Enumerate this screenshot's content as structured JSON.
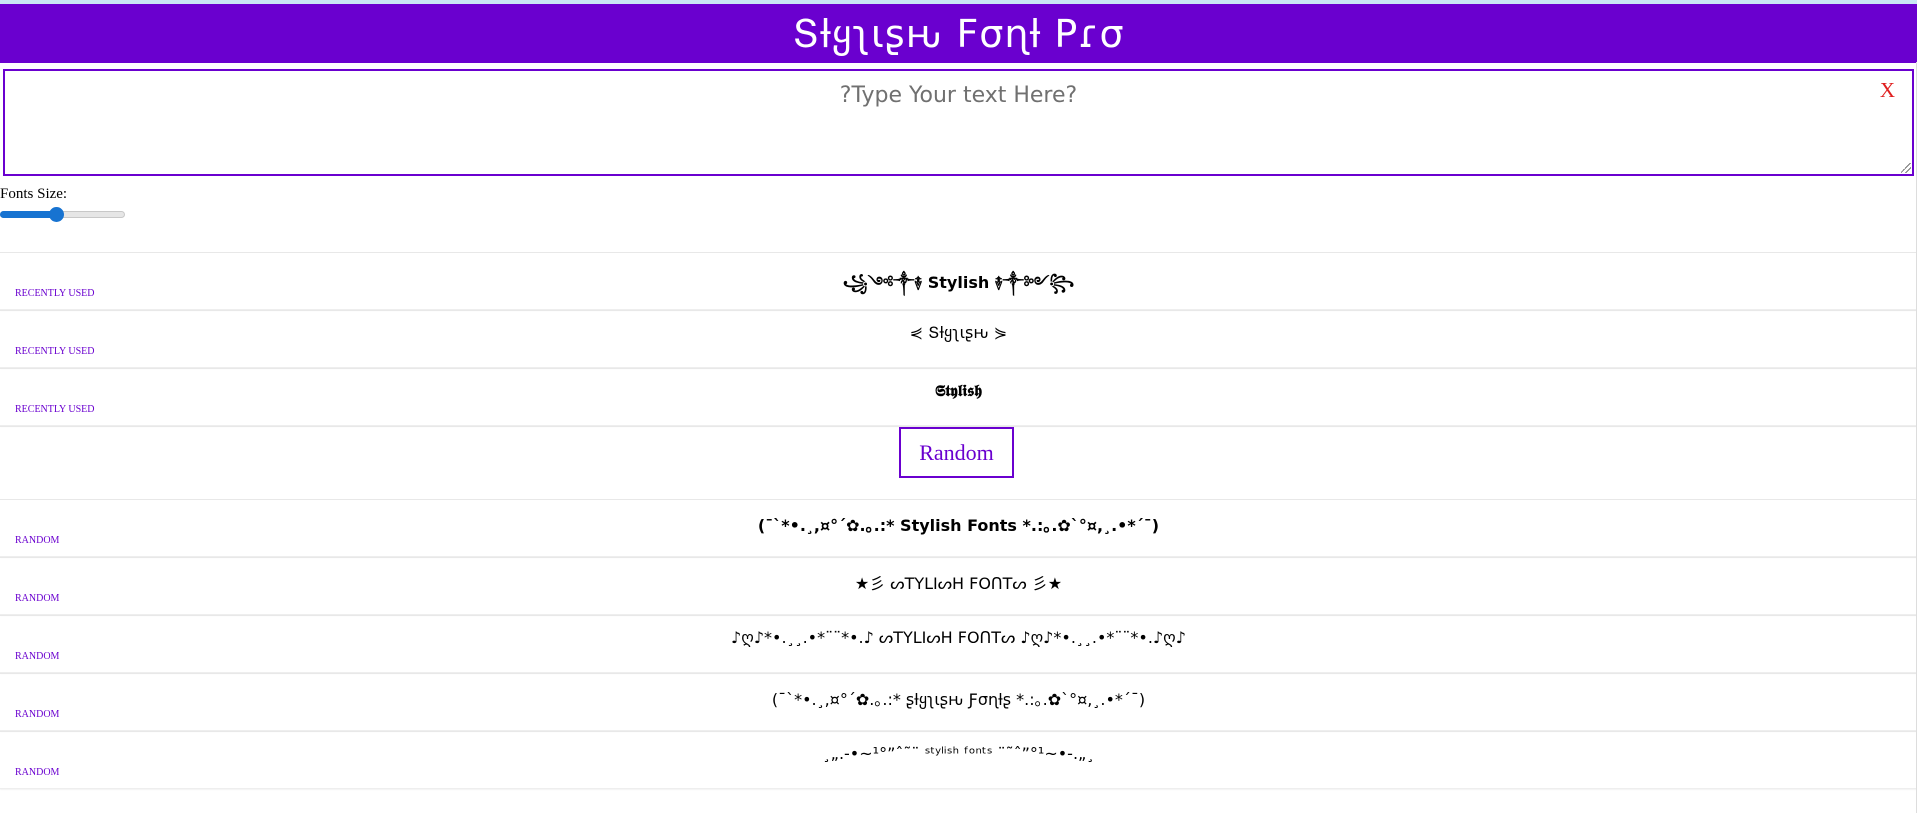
{
  "header": {
    "title": "Տƚყʅιʂԋ Fσɳƚ Pɾσ"
  },
  "input": {
    "placeholder": "?Type Your text Here?",
    "value": "",
    "clear_label": "X"
  },
  "font_size": {
    "label": "Fonts Size:",
    "value_fraction": 0.45
  },
  "recent": [
    {
      "text": "꧁༺༒࿈ Stylish ࿈༒༻꧂",
      "tag": "RECENTLY USED",
      "bold": true
    },
    {
      "text": "⋞ Տƚყʅιʂԋ ⋟",
      "tag": "RECENTLY USED",
      "bold": false
    },
    {
      "text": "𝕾𝖙𝖞𝖑𝖎𝖘𝖍",
      "tag": "RECENTLY USED",
      "bold": true
    }
  ],
  "random_button": {
    "label": "Random"
  },
  "random": [
    {
      "text": "(¯`*•.¸,¤°´✿.｡.:* Stylish Fonts *.:｡.✿`°¤,¸.•*´¯)",
      "tag": "RANDOM",
      "bold": true
    },
    {
      "text": "★彡 ᔕTYLIᔕH FOᑎTᔕ 彡★",
      "tag": "RANDOM",
      "bold": false
    },
    {
      "text": "♪ღ♪*•.¸¸.•*¨¨*•.♪ ᔕTYLIᔕH FOᑎTᔕ ♪ღ♪*•.¸¸.•*¨¨*•.♪ღ♪",
      "tag": "RANDOM",
      "bold": false
    },
    {
      "text": "(¯`*•.¸,¤°´✿.｡.:* ʂƚყʅιʂԋ Ƒσɳƚʂ *.:｡.✿`°¤,¸.•*´¯)",
      "tag": "RANDOM",
      "bold": false
    },
    {
      "text": "¸„.-•~¹°”ˆ˜¨ ˢᵗʸˡⁱˢʰ ᶠᵒⁿᵗˢ ¨˜ˆ”°¹~•-.„¸",
      "tag": "RANDOM",
      "bold": false
    }
  ]
}
